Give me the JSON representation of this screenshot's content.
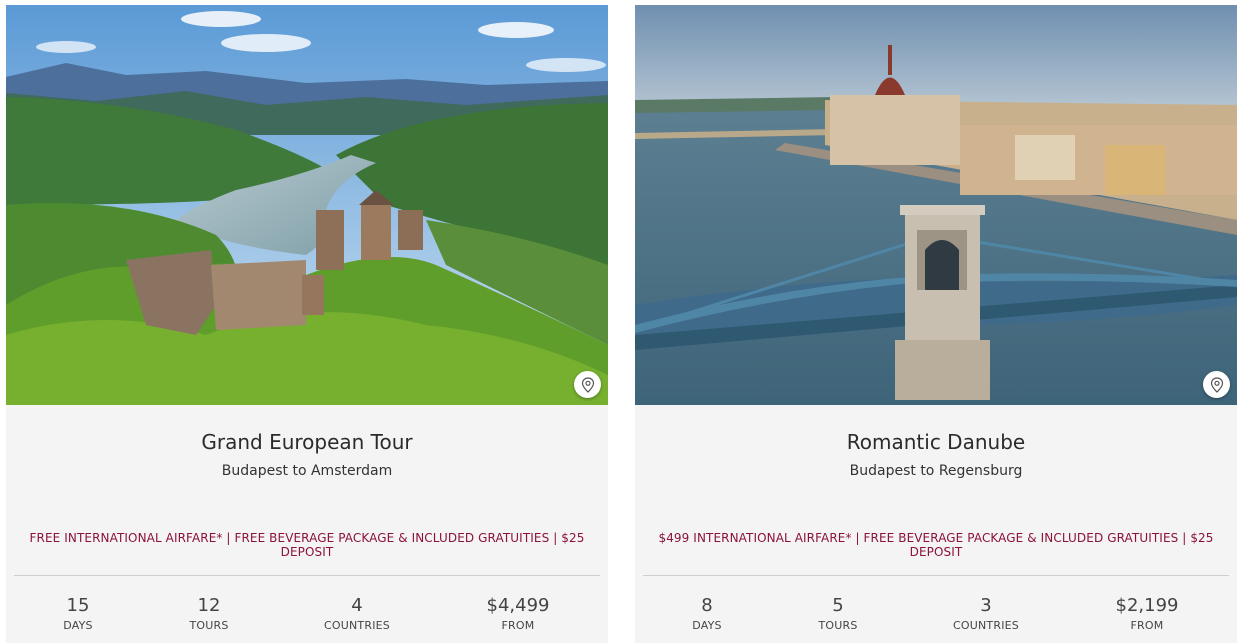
{
  "cards": [
    {
      "title": "Grand European Tour",
      "route": "Budapest to Amsterdam",
      "promo": "FREE INTERNATIONAL AIRFARE* | FREE BEVERAGE PACKAGE & INCLUDED GRATUITIES | $25 DEPOSIT",
      "image_icon": "map-pin-icon",
      "stats": [
        {
          "value": "15",
          "label": "DAYS"
        },
        {
          "value": "12",
          "label": "TOURS"
        },
        {
          "value": "4",
          "label": "COUNTRIES"
        },
        {
          "value": "$4,499",
          "label": "FROM"
        }
      ]
    },
    {
      "title": "Romantic Danube",
      "route": "Budapest to Regensburg",
      "promo": "$499 INTERNATIONAL AIRFARE* | FREE BEVERAGE PACKAGE & INCLUDED GRATUITIES | $25 DEPOSIT",
      "image_icon": "map-pin-icon",
      "stats": [
        {
          "value": "8",
          "label": "DAYS"
        },
        {
          "value": "5",
          "label": "TOURS"
        },
        {
          "value": "3",
          "label": "COUNTRIES"
        },
        {
          "value": "$2,199",
          "label": "FROM"
        }
      ]
    }
  ],
  "colors": {
    "promo_text": "#8c1238",
    "card_bg": "#f4f4f4",
    "divider": "#cfcfcf"
  }
}
